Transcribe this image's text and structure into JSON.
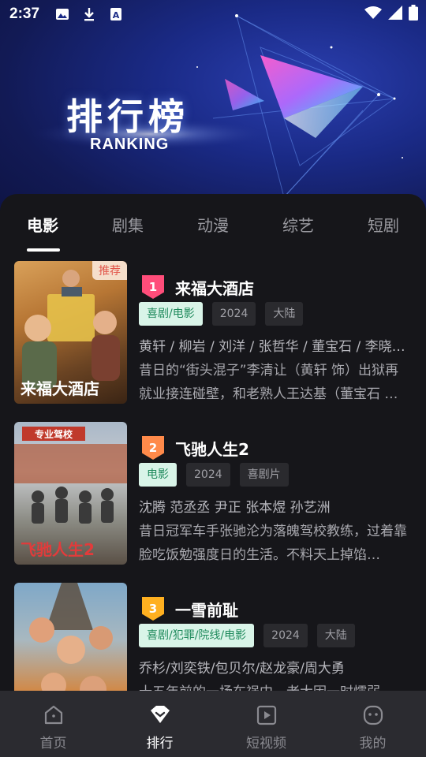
{
  "status": {
    "time": "2:37",
    "icons": [
      "image-icon",
      "download-icon",
      "font-icon",
      "wifi-icon",
      "signal-icon",
      "battery-icon"
    ]
  },
  "banner": {
    "title": "排行榜",
    "subtitle": "RANKING"
  },
  "tabs": [
    {
      "label": "电影",
      "active": true
    },
    {
      "label": "剧集",
      "active": false
    },
    {
      "label": "动漫",
      "active": false
    },
    {
      "label": "综艺",
      "active": false
    },
    {
      "label": "短剧",
      "active": false
    }
  ],
  "movies": [
    {
      "rank": "1",
      "title": "来福大酒店",
      "poster_tag": "推荐",
      "poster_text": "来福大酒店",
      "chips": [
        "喜剧/电影",
        "2024",
        "大陆"
      ],
      "cast": "黄轩 / 柳岩 / 刘洋 / 张哲华 / 董宝石 / 李晓…",
      "desc": "昔日的“街头混子”李清让（黄轩 饰）出狱再就业接连碰壁，和老熟人王达基（董宝石 …",
      "badge_color": "#ff4d7a"
    },
    {
      "rank": "2",
      "title": "飞驰人生2",
      "poster_tag": "",
      "poster_text": "飞驰人生2",
      "chips": [
        "电影",
        "2024",
        "喜剧片"
      ],
      "cast": "沈腾 范丞丞 尹正 张本煜 孙艺洲",
      "desc": "昔日冠军车手张驰沦为落魄驾校教练，过着靠脸吃饭勉强度日的生活。不料天上掉馅…",
      "badge_color": "#ff8a4a"
    },
    {
      "rank": "3",
      "title": "一雪前耻",
      "poster_tag": "",
      "poster_text": "",
      "chips": [
        "喜剧/犯罪/院线/电影",
        "2024",
        "大陆"
      ],
      "cast": "乔杉/刘奕铁/包贝尔/赵龙豪/周大勇",
      "desc": "十五年前的一场车祸中，老大因一时懦弱…",
      "badge_color": "#ffb020"
    }
  ],
  "bottom_nav": [
    {
      "label": "首页",
      "icon": "home-icon",
      "active": false
    },
    {
      "label": "排行",
      "icon": "ranking-icon",
      "active": true
    },
    {
      "label": "短视频",
      "icon": "video-icon",
      "active": false
    },
    {
      "label": "我的",
      "icon": "profile-icon",
      "active": false
    }
  ]
}
